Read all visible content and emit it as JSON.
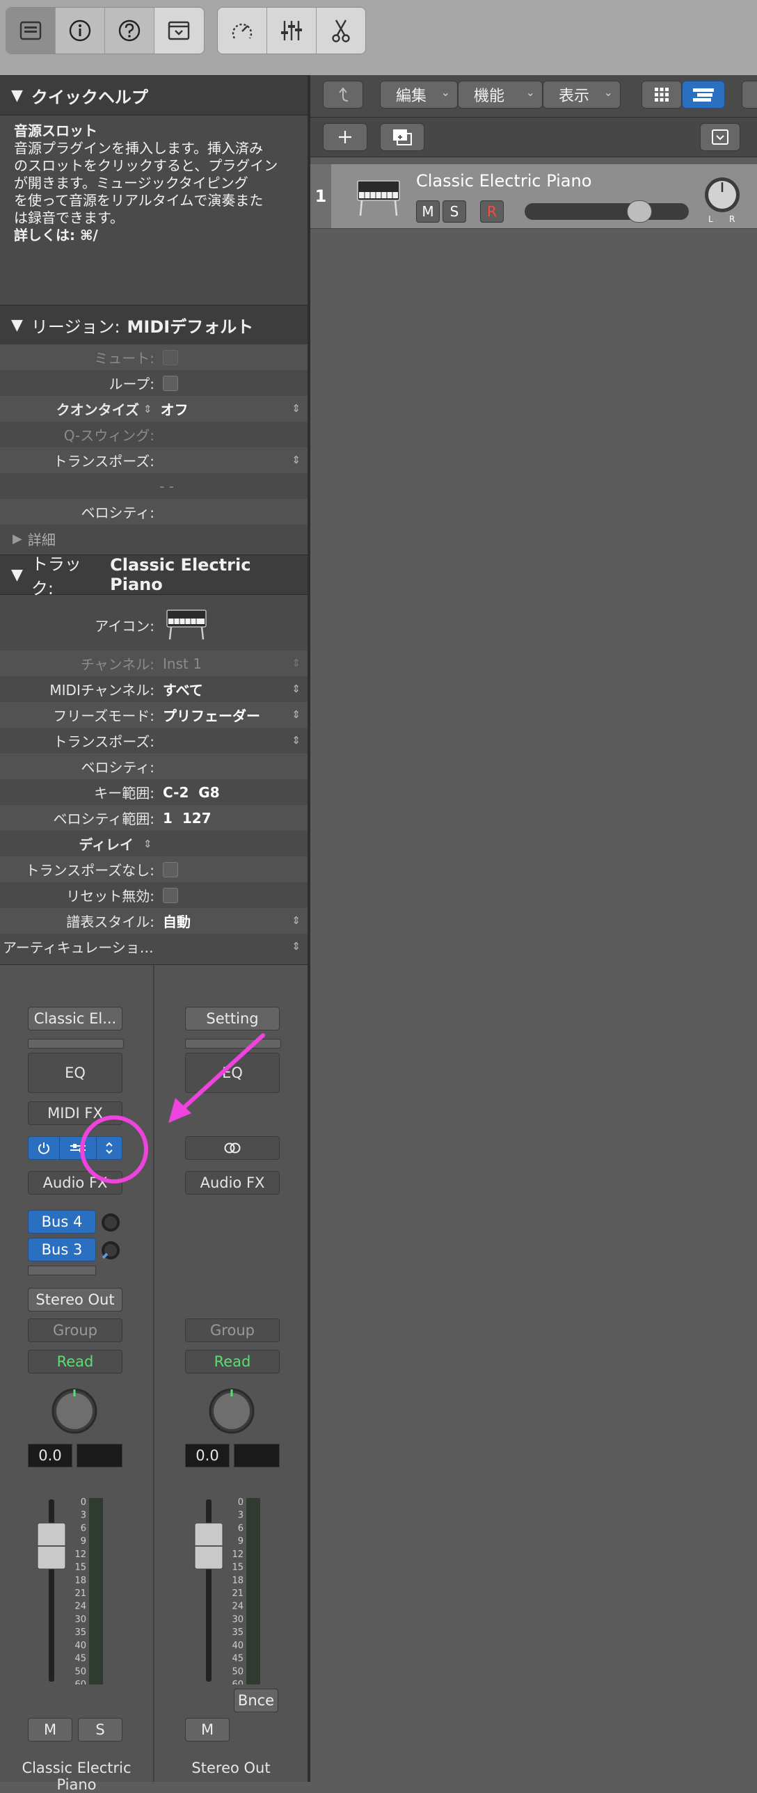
{
  "quick_help": {
    "header": "クイックヘルプ",
    "title": "音源スロット",
    "body_lines": [
      "音源プラグインを挿入します。挿入済み",
      "のスロットをクリックすると、プラグイン",
      "が開きます。ミュージックタイピング",
      "を使って音源をリアルタイムで演奏また",
      "は録音できます。"
    ],
    "more": "詳しくは: ⌘/"
  },
  "region": {
    "header_label": "リージョン:",
    "header_value": "MIDIデフォルト",
    "rows": {
      "mute": "ミュート:",
      "loop": "ループ:",
      "quantize": "クオンタイズ",
      "quantize_value": "オフ",
      "qswing": "Q-スウィング:",
      "transpose": "トランスポーズ:",
      "dashes": "- -",
      "velocity": "ベロシティ:",
      "detail": "詳細"
    }
  },
  "track": {
    "header_label": "トラック:",
    "header_value": "Classic Electric Piano",
    "rows": {
      "icon": "アイコン:",
      "channel": "チャンネル:",
      "channel_value": "Inst 1",
      "midi_channel": "MIDIチャンネル:",
      "midi_channel_value": "すべて",
      "freeze": "フリーズモード:",
      "freeze_value": "プリフェーダー",
      "transpose": "トランスポーズ:",
      "velocity": "ベロシティ:",
      "key_range": "キー範囲:",
      "key_range_value": "C-2  G8",
      "vel_range": "ベロシティ範囲:",
      "vel_range_value": "1  127",
      "delay": "ディレイ",
      "no_transpose": "トランスポーズなし:",
      "no_reset": "リセット無効:",
      "score_style": "譜表スタイル:",
      "score_style_value": "自動",
      "articulation": "アーティキュレーショ…"
    }
  },
  "mixer": {
    "strip1": {
      "setting": "Classic El...",
      "eq": "EQ",
      "midi_fx": "MIDI FX",
      "audio_fx": "Audio FX",
      "bus1": "Bus 4",
      "bus2": "Bus 3",
      "output": "Stereo Out",
      "group": "Group",
      "automation": "Read",
      "volume": "0.0",
      "mute": "M",
      "solo": "S",
      "name": "Classic Electric Piano"
    },
    "strip2": {
      "setting": "Setting",
      "eq": "EQ",
      "audio_fx": "Audio FX",
      "group": "Group",
      "automation": "Read",
      "volume": "0.0",
      "bounce": "Bnce",
      "mute": "M",
      "name": "Stereo Out"
    },
    "meter_scale": [
      "0",
      "3",
      "6",
      "9",
      "12",
      "15",
      "18",
      "21",
      "24",
      "30",
      "35",
      "40",
      "45",
      "50",
      "60"
    ]
  },
  "toolbar": {
    "edit": "編集",
    "function": "機能",
    "view": "表示"
  },
  "track_header": {
    "number": "1",
    "name": "Classic Electric Piano",
    "mute": "M",
    "solo": "S",
    "record": "R",
    "pan_left": "L",
    "pan_right": "R",
    "volume_level": 0.75
  },
  "annotation": {
    "color": "#ee44dd"
  }
}
